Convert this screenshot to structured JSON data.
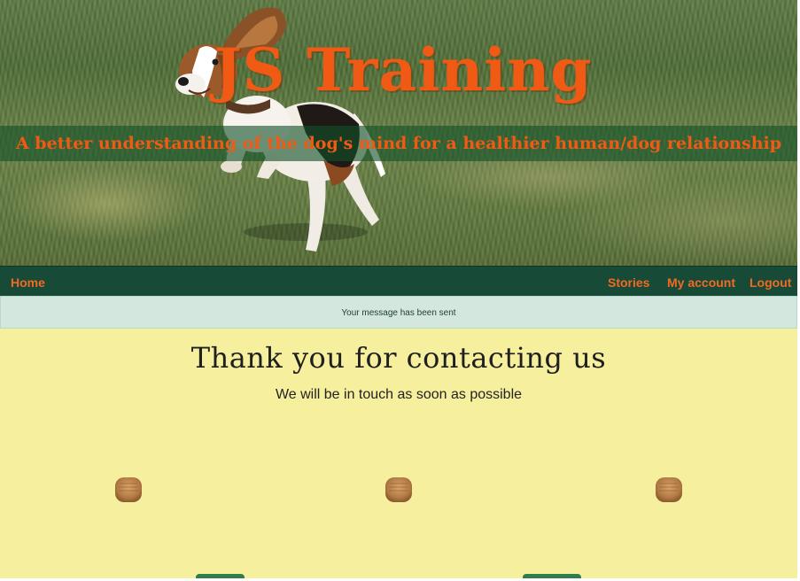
{
  "hero": {
    "title": "JS Training",
    "tagline": "A better understanding of the dog's mind for a healthier human/dog relationship"
  },
  "nav": {
    "home": "Home",
    "stories": "Stories",
    "my_account": "My account",
    "logout": "Logout"
  },
  "alert": {
    "message": "Your message has been sent"
  },
  "main": {
    "heading": "Thank you for contacting us",
    "subheading": "We will be in touch as soon as possible"
  },
  "colors": {
    "accent_orange": "#f05a14",
    "nav_green": "#174a37",
    "alert_bg": "#d3e7df",
    "content_bg": "#f6ef9d",
    "button_green": "#2e7d4a"
  },
  "icons": {
    "treat": "dog-treat-icon",
    "dog": "beagle-photo"
  }
}
